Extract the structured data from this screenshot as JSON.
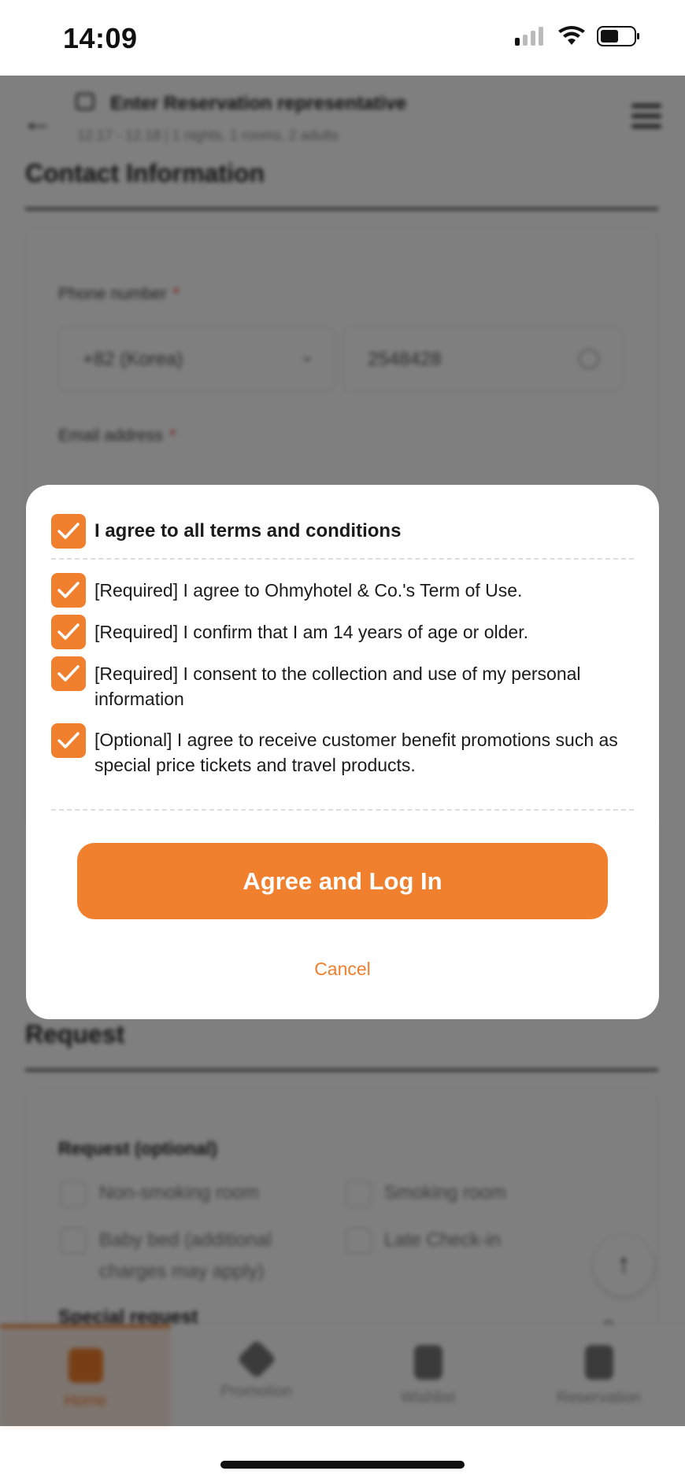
{
  "status_bar": {
    "time": "14:09"
  },
  "app_header": {
    "title": "Enter Reservation representative",
    "subtitle": "12.17 - 12.18 | 1 nights, 1 rooms, 2 adults"
  },
  "contact": {
    "section_title": "Contact Information",
    "phone_label": "Phone number",
    "country_value": "+82 (Korea)",
    "phone_value": "2548428",
    "email_label": "Email address",
    "required_mark": "*"
  },
  "request": {
    "section_title": "Request",
    "label": "Request (optional)",
    "options": [
      "Non-smoking room",
      "Smoking room",
      "Baby bed (additional charges may apply)",
      "Late Check-in"
    ],
    "special_label": "Special request"
  },
  "bottom_nav": {
    "items": [
      {
        "label": "Home",
        "active": true
      },
      {
        "label": "Promotion",
        "active": false
      },
      {
        "label": "Wishlist",
        "active": false
      },
      {
        "label": "Reservation",
        "active": false
      }
    ]
  },
  "modal": {
    "all_terms_label": "I agree to all terms and conditions",
    "all_terms_checked": true,
    "terms": [
      {
        "label": "[Required] I agree to Ohmyhotel & Co.'s Term of Use.",
        "checked": true
      },
      {
        "label": "[Required] I confirm that I am 14 years of age or older.",
        "checked": true
      },
      {
        "label": "[Required] I consent to the collection and use of my personal information",
        "checked": true
      },
      {
        "label": "[Optional] I agree to receive customer benefit promotions such as special price tickets and travel products.",
        "checked": true
      }
    ],
    "agree_button": "Agree and Log In",
    "cancel_button": "Cancel"
  },
  "colors": {
    "accent": "#f07f2e",
    "overlay": "rgba(0,0,0,0.5)"
  }
}
